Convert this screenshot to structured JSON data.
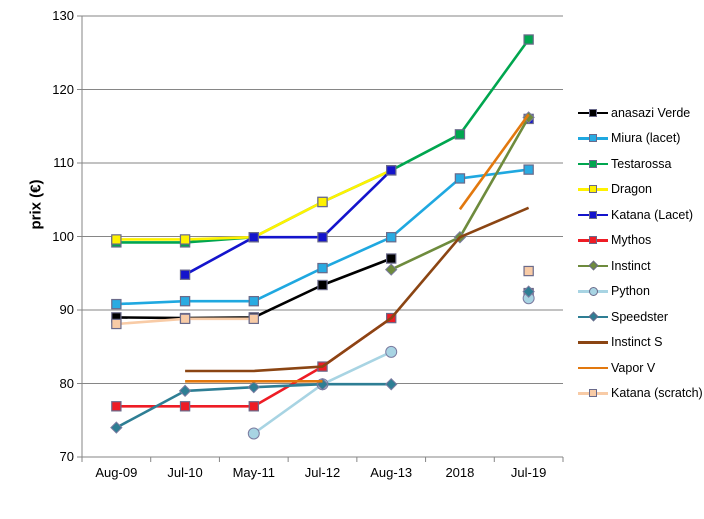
{
  "chart_data": {
    "type": "line",
    "title": "",
    "xlabel": "",
    "ylabel": "prix (€)",
    "categories": [
      "Aug-09",
      "Jul-10",
      "May-11",
      "Jul-12",
      "Aug-13",
      "2018",
      "Jul-19"
    ],
    "ylim": [
      70,
      130
    ],
    "yticks": [
      70,
      80,
      90,
      100,
      110,
      120,
      130
    ],
    "grid": true,
    "legend_position": "right",
    "series": [
      {
        "name": "anasazi Verde",
        "color": "#000000",
        "marker": "square",
        "marker_fill": "#000000",
        "values": [
          89,
          88.9,
          89,
          93.4,
          97,
          null,
          null
        ]
      },
      {
        "name": "Miura (lacet)",
        "color": "#1FA8E0",
        "marker": "square",
        "marker_fill": "#29ABE2",
        "values": [
          90.8,
          91.2,
          91.2,
          95.7,
          99.9,
          107.9,
          109.1
        ]
      },
      {
        "name": "Testarossa",
        "color": "#00A64F",
        "marker": "square",
        "marker_fill": "#00A64F",
        "values": [
          99.2,
          99.2,
          99.9,
          104.7,
          109,
          113.9,
          126.8
        ]
      },
      {
        "name": "Dragon",
        "color": "#FFF200",
        "marker": "square",
        "marker_fill": "#FFF200",
        "values": [
          99.6,
          99.6,
          99.9,
          104.7,
          109,
          null,
          null
        ]
      },
      {
        "name": "Katana (Lacet)",
        "color": "#1414CC",
        "marker": "square",
        "marker_fill": "#1414CC",
        "values": [
          null,
          94.8,
          99.9,
          99.9,
          109,
          null,
          116
        ]
      },
      {
        "name": "Mythos",
        "color": "#EE1C25",
        "marker": "square",
        "marker_fill": "#EE1C25",
        "values": [
          76.9,
          76.9,
          76.9,
          82.3,
          88.9,
          null,
          92.3
        ]
      },
      {
        "name": "Instinct",
        "color": "#6E8B3D",
        "marker": "diamond",
        "marker_fill": "#6E8B3D",
        "values": [
          null,
          null,
          null,
          null,
          95.5,
          99.9,
          116.2
        ]
      },
      {
        "name": "Python",
        "color": "#A8D4E3",
        "marker": "circle",
        "marker_fill": "#A8D4E3",
        "values": [
          null,
          null,
          73.2,
          79.9,
          84.3,
          null,
          91.6
        ]
      },
      {
        "name": "Speedster",
        "color": "#2E7E94",
        "marker": "diamond",
        "marker_fill": "#2E7E94",
        "values": [
          74,
          79,
          79.5,
          79.9,
          79.9,
          null,
          92.5
        ]
      },
      {
        "name": "Instinct S",
        "color": "#8B4513",
        "marker": "none",
        "marker_fill": "#8B4513",
        "values": [
          null,
          81.7,
          81.7,
          82.3,
          88.9,
          99.9,
          103.9
        ]
      },
      {
        "name": "Vapor V",
        "color": "#E2780E",
        "marker": "none",
        "marker_fill": "#E2780E",
        "values": [
          null,
          80.3,
          80.3,
          80.3,
          null,
          103.7,
          116.6
        ]
      },
      {
        "name": "Katana (scratch)",
        "color": "#F8CBA6",
        "marker": "square",
        "marker_fill": "#F8CBA6",
        "values": [
          88.1,
          88.8,
          88.8,
          null,
          null,
          null,
          95.3
        ]
      }
    ]
  },
  "axis": {
    "y_title": "prix (€)",
    "y_tick_labels": [
      "130",
      "120",
      "110",
      "100",
      "90",
      "80",
      "70"
    ],
    "x_tick_labels": [
      "Aug-09",
      "Jul-10",
      "May-11",
      "Jul-12",
      "Aug-13",
      "2018",
      "Jul-19"
    ]
  },
  "legend": {
    "items": [
      {
        "label": "anasazi Verde"
      },
      {
        "label": "Miura (lacet)"
      },
      {
        "label": "Testarossa"
      },
      {
        "label": "Dragon"
      },
      {
        "label": "Katana (Lacet)"
      },
      {
        "label": "Mythos"
      },
      {
        "label": "Instinct"
      },
      {
        "label": "Python"
      },
      {
        "label": "Speedster"
      },
      {
        "label": "Instinct S"
      },
      {
        "label": "Vapor V"
      },
      {
        "label": "Katana (scratch)"
      }
    ]
  }
}
